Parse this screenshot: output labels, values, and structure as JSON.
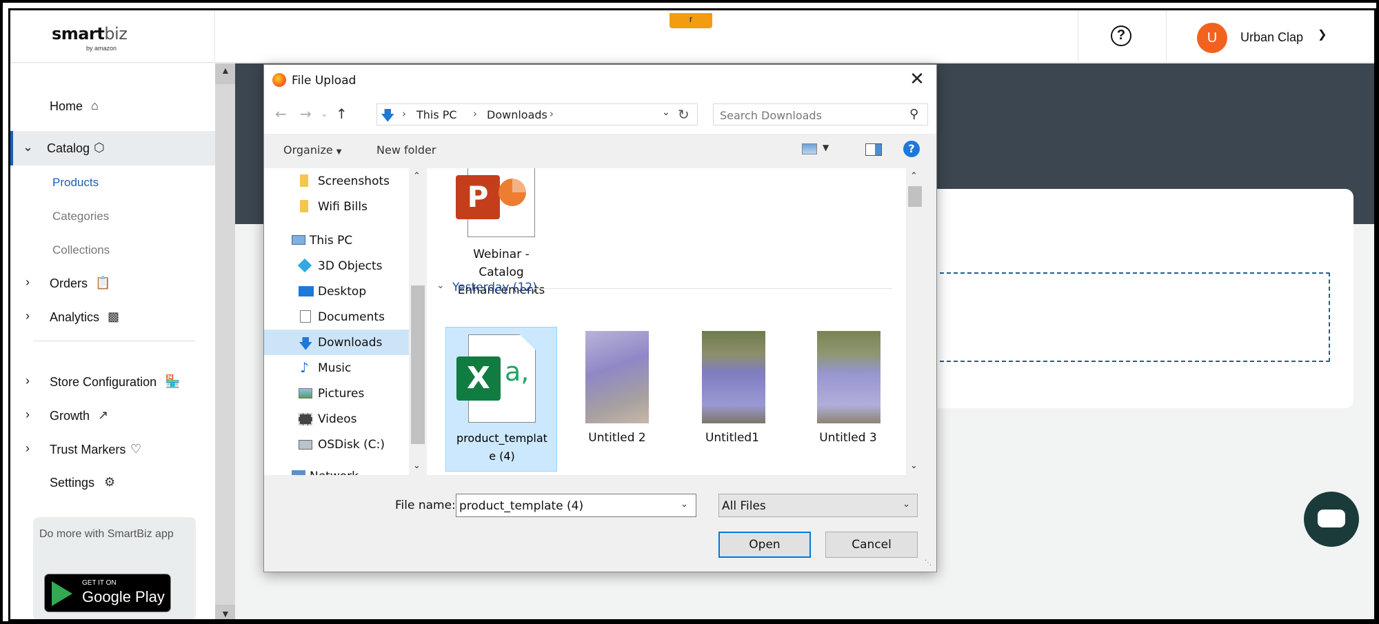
{
  "app": {
    "logo_main": "smart",
    "logo_accent": "biz",
    "logo_sub": "by amazon",
    "top_tab": "r",
    "help_glyph": "?",
    "user_initial": "U",
    "user_name": "Urban Clap",
    "accent_color": "#f2621f"
  },
  "sidebar": {
    "home": "Home",
    "catalog": "Catalog",
    "products": "Products",
    "categories": "Categories",
    "collections": "Collections",
    "orders": "Orders",
    "analytics": "Analytics",
    "store_configuration": "Store Configuration",
    "growth": "Growth",
    "trust_markers": "Trust Markers",
    "settings": "Settings",
    "promo_text": "Do more with SmartBiz app",
    "gplay_small": "GET IT ON",
    "gplay_big": "Google Play"
  },
  "dialog": {
    "title": "File Upload",
    "path": [
      "This PC",
      "Downloads"
    ],
    "search_placeholder": "Search Downloads",
    "organize": "Organize",
    "new_folder": "New folder",
    "tree": [
      {
        "label": "Screenshots",
        "icon": "folder-icon"
      },
      {
        "label": "Wifi Bills",
        "icon": "folder-icon"
      },
      {
        "label": "This PC",
        "icon": "computer-icon"
      },
      {
        "label": "3D Objects",
        "icon": "3d-objects-icon"
      },
      {
        "label": "Desktop",
        "icon": "desktop-icon"
      },
      {
        "label": "Documents",
        "icon": "documents-icon"
      },
      {
        "label": "Downloads",
        "icon": "downloads-icon"
      },
      {
        "label": "Music",
        "icon": "music-icon"
      },
      {
        "label": "Pictures",
        "icon": "pictures-icon"
      },
      {
        "label": "Videos",
        "icon": "videos-icon"
      },
      {
        "label": "OSDisk (C:)",
        "icon": "disk-icon"
      },
      {
        "label": "Network",
        "icon": "network-icon"
      }
    ],
    "top_file": {
      "name": "Webinar - Catalog Enhancements",
      "name_lines": [
        "Webinar -",
        "Catalog",
        "Enhancements"
      ],
      "type": "powerpoint"
    },
    "group_header": "Yesterday (12)",
    "files": [
      {
        "name": "product_template (4)",
        "name_lines": [
          "product_templat",
          "e (4)"
        ],
        "type": "excel",
        "selected": true
      },
      {
        "name": "Untitled 2",
        "type": "image"
      },
      {
        "name": "Untitled1",
        "type": "image"
      },
      {
        "name": "Untitled 3",
        "type": "image"
      }
    ],
    "file_name_label": "File name:",
    "file_name_value": "product_template (4)",
    "file_type_value": "All Files",
    "open_label": "Open",
    "cancel_label": "Cancel"
  }
}
